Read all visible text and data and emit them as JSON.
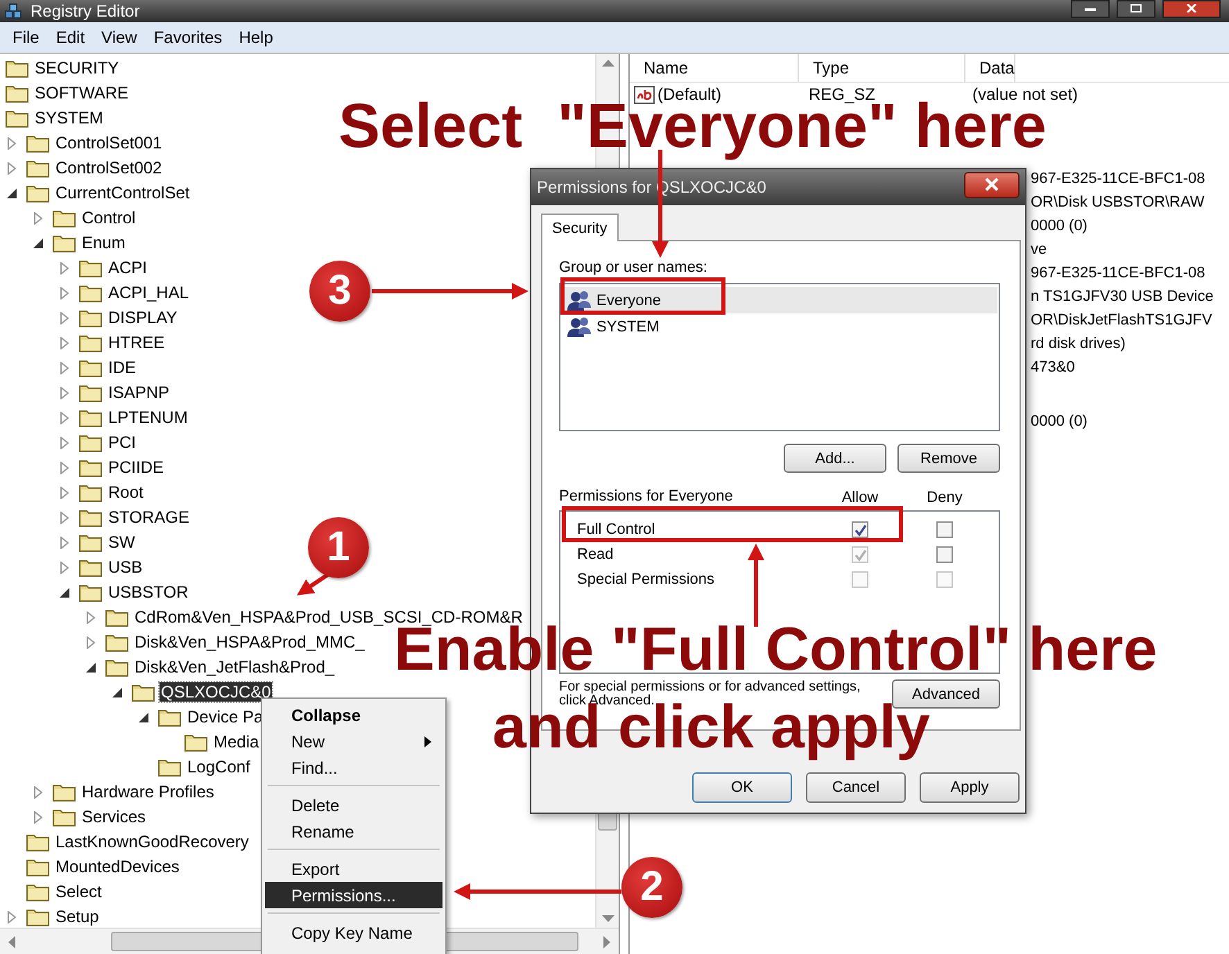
{
  "window": {
    "title": "Registry Editor"
  },
  "menu_bar": [
    "File",
    "Edit",
    "View",
    "Favorites",
    "Help"
  ],
  "tree": [
    {
      "label": "SECURITY",
      "selected": false
    },
    {
      "label": "SOFTWARE",
      "selected": false
    },
    {
      "label": "SYSTEM",
      "selected": false,
      "children": [
        {
          "label": "ControlSet001",
          "selected": false,
          "expanded": false
        },
        {
          "label": "ControlSet002",
          "selected": false,
          "expanded": false
        },
        {
          "label": "CurrentControlSet",
          "selected": false,
          "expanded": true,
          "children": [
            {
              "label": "Control",
              "selected": false,
              "expanded": false
            },
            {
              "label": "Enum",
              "selected": false,
              "expanded": true,
              "children": [
                {
                  "label": "ACPI",
                  "selected": false,
                  "expanded": false
                },
                {
                  "label": "ACPI_HAL",
                  "selected": false,
                  "expanded": false
                },
                {
                  "label": "DISPLAY",
                  "selected": false,
                  "expanded": false
                },
                {
                  "label": "HTREE",
                  "selected": false,
                  "expanded": false
                },
                {
                  "label": "IDE",
                  "selected": false,
                  "expanded": false
                },
                {
                  "label": "ISAPNP",
                  "selected": false,
                  "expanded": false
                },
                {
                  "label": "LPTENUM",
                  "selected": false,
                  "expanded": false
                },
                {
                  "label": "PCI",
                  "selected": false,
                  "expanded": false
                },
                {
                  "label": "PCIIDE",
                  "selected": false,
                  "expanded": false
                },
                {
                  "label": "Root",
                  "selected": false,
                  "expanded": false
                },
                {
                  "label": "STORAGE",
                  "selected": false,
                  "expanded": false
                },
                {
                  "label": "SW",
                  "selected": false,
                  "expanded": false
                },
                {
                  "label": "USB",
                  "selected": false,
                  "expanded": false
                },
                {
                  "label": "USBSTOR",
                  "selected": false,
                  "expanded": true,
                  "children": [
                    {
                      "label": "CdRom&Ven_HSPA&Prod_USB_SCSI_CD-ROM&R",
                      "selected": false,
                      "expanded": false
                    },
                    {
                      "label": "Disk&Ven_HSPA&Prod_MMC_",
                      "selected": false,
                      "expanded": false
                    },
                    {
                      "label": "Disk&Ven_JetFlash&Prod_",
                      "selected": false,
                      "expanded": true,
                      "children": [
                        {
                          "label": "QSLXOCJC&0",
                          "selected": true,
                          "expanded": true,
                          "children": [
                            {
                              "label": "Device Pa",
                              "selected": false,
                              "expanded": true,
                              "children": [
                                {
                                  "label": "Media",
                                  "selected": false
                                }
                              ]
                            },
                            {
                              "label": "LogConf",
                              "selected": false
                            }
                          ]
                        }
                      ]
                    }
                  ]
                }
              ]
            },
            {
              "label": "Hardware Profiles",
              "selected": false,
              "expanded": false
            },
            {
              "label": "Services",
              "selected": false,
              "expanded": false
            }
          ]
        },
        {
          "label": "LastKnownGoodRecovery",
          "selected": false
        },
        {
          "label": "MountedDevices",
          "selected": false
        },
        {
          "label": "Select",
          "selected": false
        },
        {
          "label": "Setup",
          "selected": false,
          "expanded": false
        }
      ]
    }
  ],
  "values": {
    "columns": [
      "Name",
      "Type",
      "Data"
    ],
    "rows": [
      {
        "kind": "string",
        "name": "(Default)",
        "type": "REG_SZ",
        "data": "(value not set)"
      },
      {
        "kind": "covered"
      },
      {
        "kind": "covered"
      },
      {
        "kind": "covered",
        "data": "967-E325-11CE-BFC1-08"
      },
      {
        "kind": "covered",
        "data": "OR\\Disk USBSTOR\\RAW"
      },
      {
        "kind": "covered",
        "data": "0000 (0)"
      },
      {
        "kind": "covered",
        "data": "ve"
      },
      {
        "kind": "covered",
        "data": "967-E325-11CE-BFC1-08"
      },
      {
        "kind": "covered",
        "data": "n TS1GJFV30 USB Device"
      },
      {
        "kind": "covered",
        "data": "OR\\DiskJetFlashTS1GJFV"
      },
      {
        "kind": "covered",
        "data": "rd disk drives)"
      },
      {
        "kind": "covered",
        "data": "473&0"
      },
      {
        "kind": "covered"
      },
      {
        "kind": "covered",
        "data": "0000 (0)"
      }
    ]
  },
  "context_menu": [
    {
      "kind": "item",
      "label": "Collapse",
      "default": true,
      "selected": false
    },
    {
      "kind": "item",
      "label": "New",
      "submenu": true,
      "selected": false
    },
    {
      "kind": "item",
      "label": "Find...",
      "selected": false
    },
    {
      "kind": "separator"
    },
    {
      "kind": "item",
      "label": "Delete",
      "selected": false
    },
    {
      "kind": "item",
      "label": "Rename",
      "selected": false
    },
    {
      "kind": "separator"
    },
    {
      "kind": "item",
      "label": "Export",
      "selected": false
    },
    {
      "kind": "item",
      "label": "Permissions...",
      "selected": true
    },
    {
      "kind": "separator"
    },
    {
      "kind": "item",
      "label": "Copy Key Name",
      "selected": false
    }
  ],
  "dialog": {
    "title": "Permissions for QSLXOCJC&0",
    "tabs": [
      {
        "label": "Security",
        "selected": true
      }
    ],
    "group_label": "Group or user names:",
    "groups": [
      {
        "name": "Everyone",
        "selected": true
      },
      {
        "name": "SYSTEM",
        "selected": false
      }
    ],
    "group_buttons": [
      "Add...",
      "Remove"
    ],
    "permissions_label": "Permissions for Everyone",
    "allow_label": "Allow",
    "deny_label": "Deny",
    "permissions": [
      {
        "name": "Full Control",
        "allow": {
          "checked": true,
          "disabled": false
        },
        "deny": {
          "checked": false,
          "disabled": false
        }
      },
      {
        "name": "Read",
        "allow": {
          "checked": true,
          "disabled": true
        },
        "deny": {
          "checked": false,
          "disabled": false
        }
      },
      {
        "name": "Special Permissions",
        "allow": {
          "checked": false,
          "disabled": true
        },
        "deny": {
          "checked": false,
          "disabled": true
        }
      }
    ],
    "advanced_note": "For special permissions or for advanced settings, click Advanced.",
    "advanced_button": "Advanced",
    "buttons": [
      "OK",
      "Cancel",
      "Apply"
    ]
  },
  "annotations": {
    "captions": [
      "Select  \"Everyone\" here",
      "Enable \"Full Control\" here",
      "and click apply"
    ],
    "steps": [
      "3",
      "1",
      "2"
    ]
  }
}
